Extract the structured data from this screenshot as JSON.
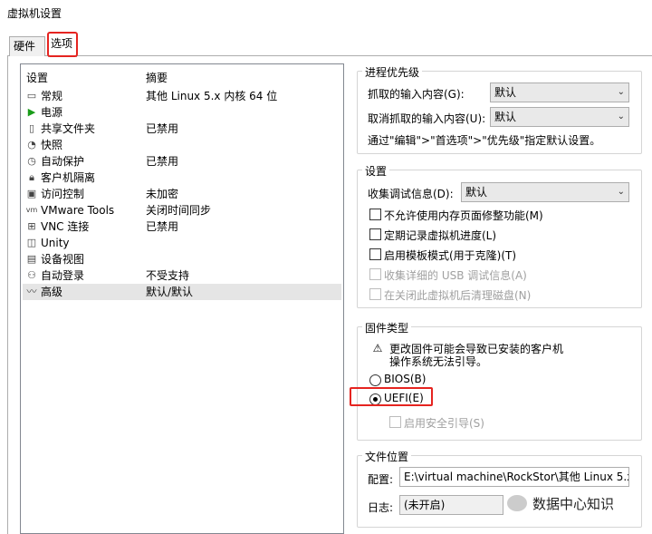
{
  "window": {
    "title": "虚拟机设置"
  },
  "tabs": [
    {
      "label": "硬件",
      "active": false
    },
    {
      "label": "选项",
      "active": true
    }
  ],
  "list": {
    "headers": {
      "setting": "设置",
      "summary": "摘要"
    },
    "rows": [
      {
        "icon": "monitor-icon",
        "name": "常规",
        "summary": "其他 Linux 5.x 内核 64 位"
      },
      {
        "icon": "power-icon",
        "name": "电源",
        "summary": ""
      },
      {
        "icon": "shared-folder-icon",
        "name": "共享文件夹",
        "summary": "已禁用"
      },
      {
        "icon": "snapshot-icon",
        "name": "快照",
        "summary": ""
      },
      {
        "icon": "autoprotect-icon",
        "name": "自动保护",
        "summary": "已禁用"
      },
      {
        "icon": "lock-icon",
        "name": "客户机隔离",
        "summary": ""
      },
      {
        "icon": "access-control-icon",
        "name": "访问控制",
        "summary": "未加密"
      },
      {
        "icon": "vmware-tools-icon",
        "name": "VMware Tools",
        "summary": "关闭时间同步"
      },
      {
        "icon": "vnc-icon",
        "name": "VNC 连接",
        "summary": "已禁用"
      },
      {
        "icon": "unity-icon",
        "name": "Unity",
        "summary": ""
      },
      {
        "icon": "appliance-view-icon",
        "name": "设备视图",
        "summary": ""
      },
      {
        "icon": "autologin-icon",
        "name": "自动登录",
        "summary": "不受支持"
      },
      {
        "icon": "advanced-icon",
        "name": "高级",
        "summary": "默认/默认",
        "selected": true
      }
    ]
  },
  "process_priority": {
    "title": "进程优先级",
    "grabbed_label": "抓取的输入内容(G):",
    "grabbed_value": "默认",
    "ungrabbed_label": "取消抓取的输入内容(U):",
    "ungrabbed_value": "默认",
    "hint": "通过\"编辑\">\"首选项\">\"优先级\"指定默认设置。"
  },
  "settings": {
    "title": "设置",
    "debug_label": "收集调试信息(D):",
    "debug_value": "默认",
    "checkboxes": [
      {
        "label": "不允许使用内存页面修整功能(M)",
        "checked": false,
        "disabled": false
      },
      {
        "label": "定期记录虚拟机进度(L)",
        "checked": false,
        "disabled": false
      },
      {
        "label": "启用模板模式(用于克隆)(T)",
        "checked": false,
        "disabled": false
      },
      {
        "label": "收集详细的 USB 调试信息(A)",
        "checked": false,
        "disabled": true
      },
      {
        "label": "在关闭此虚拟机后清理磁盘(N)",
        "checked": false,
        "disabled": true
      }
    ]
  },
  "firmware": {
    "title": "固件类型",
    "warning_line1": "更改固件可能会导致已安装的客户机",
    "warning_line2": "操作系统无法引导。",
    "bios_label": "BIOS(B)",
    "uefi_label": "UEFI(E)",
    "selected": "UEFI",
    "secure_boot_label": "启用安全引导(S)",
    "secure_boot_checked": false
  },
  "file_location": {
    "title": "文件位置",
    "config_label": "配置:",
    "config_value": "E:\\virtual machine\\RockStor\\其他 Linux 5.x 内",
    "log_label": "日志:",
    "log_value": "(未开启)"
  },
  "watermark": {
    "text": "数据中心知识"
  },
  "colors": {
    "highlight": "#e52420",
    "selected_row": "#e5e5e5",
    "power_green": "#1a9c1a"
  }
}
